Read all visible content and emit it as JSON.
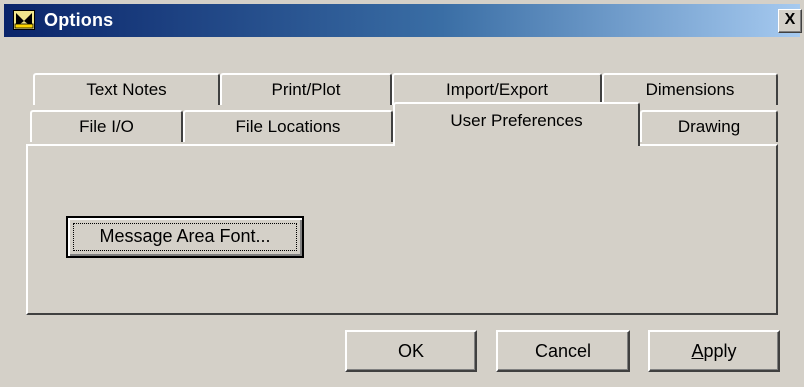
{
  "window": {
    "title": "Options",
    "close_label": "X"
  },
  "tabs": {
    "row_back": [
      {
        "label": "Text Notes"
      },
      {
        "label": "Print/Plot"
      },
      {
        "label": "Import/Export"
      },
      {
        "label": "Dimensions"
      }
    ],
    "row_front": [
      {
        "label": "File I/O"
      },
      {
        "label": "File Locations"
      },
      {
        "label": "User Preferences",
        "selected": true
      },
      {
        "label": "Drawing"
      }
    ]
  },
  "panel": {
    "message_font_button": "Message Area Font..."
  },
  "buttons": {
    "ok": "OK",
    "cancel": "Cancel",
    "apply": "Apply"
  }
}
